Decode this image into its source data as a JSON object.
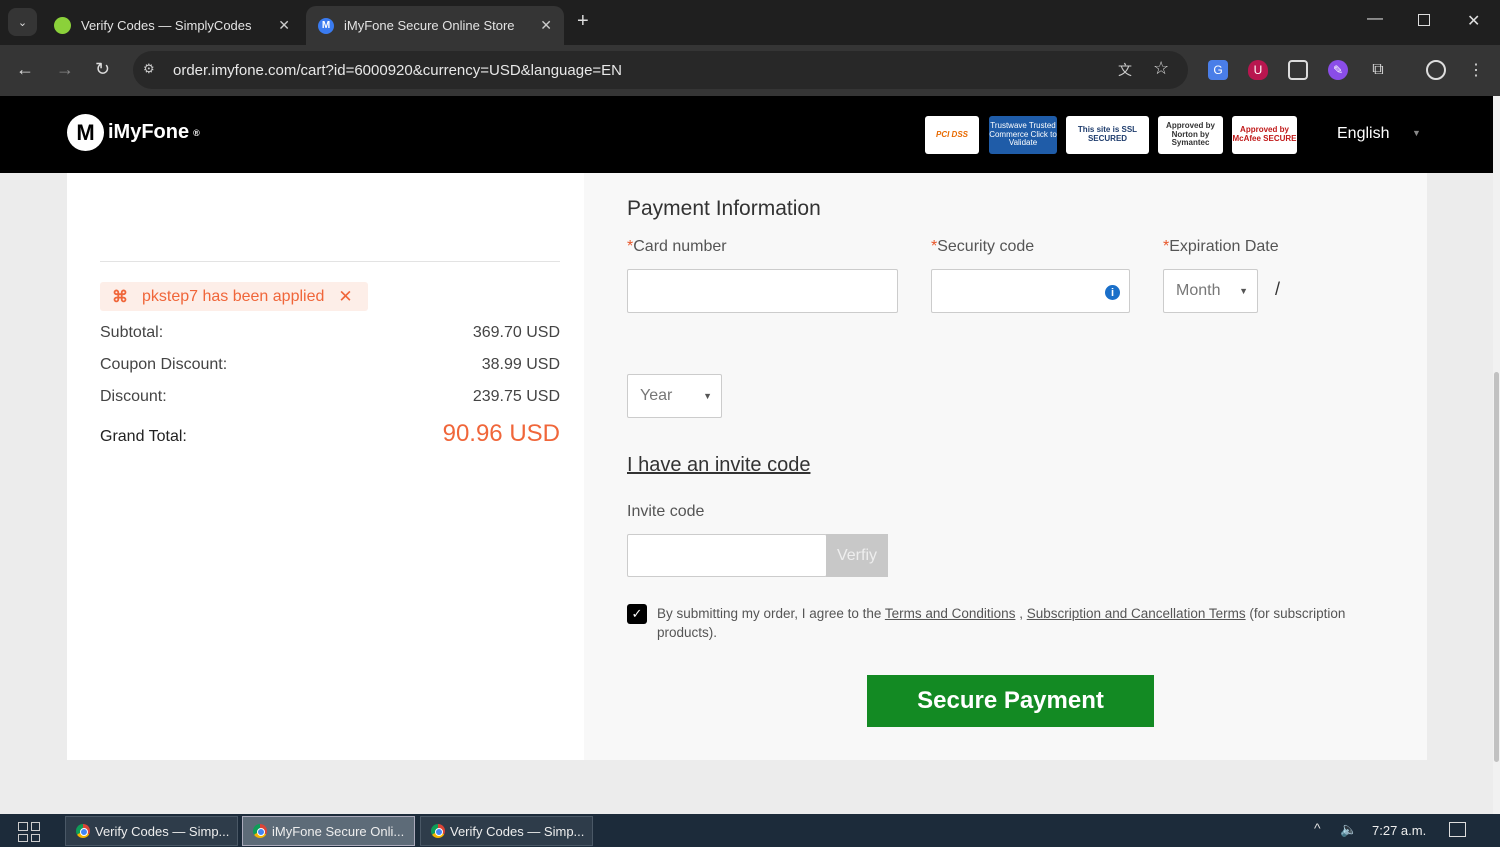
{
  "browser": {
    "tabs": [
      {
        "title": "Verify Codes — SimplyCodes",
        "active": false
      },
      {
        "title": "iMyFone Secure Online Store",
        "active": true
      }
    ],
    "url": "order.imyfone.com/cart?id=6000920&currency=USD&language=EN"
  },
  "header": {
    "logo": "iMyFone",
    "badges": [
      "PCI DSS",
      "Trustwave Trusted Commerce Click to Validate",
      "This site is SSL SECURED",
      "Approved by Norton by Symantec",
      "Approved by McAfee SECURE"
    ],
    "language": "English"
  },
  "summary": {
    "coupon_text": "pkstep7 has been applied",
    "rows": [
      {
        "label": "Subtotal:",
        "value": "369.70 USD"
      },
      {
        "label": "Coupon Discount:",
        "value": "38.99 USD"
      },
      {
        "label": "Discount:",
        "value": "239.75 USD"
      }
    ],
    "grand_total_label": "Grand Total:",
    "grand_total_value": "90.96 USD"
  },
  "payment": {
    "title": "Payment Information",
    "card_label": "Card number",
    "security_label": "Security code",
    "expiration_label": "Expiration Date",
    "required_mark": "*",
    "month_value": "Month",
    "separator": "/",
    "year_value": "Year",
    "invite_link": "I have an invite code",
    "invite_label": "Invite code",
    "verify_label": "Verfiy",
    "agree_prefix": "By submitting my order, I agree to the ",
    "terms_link": "Terms and Conditions",
    "comma": " , ",
    "subscription_link": "Subscription and Cancellation Terms",
    "agree_suffix": " (for subscription products).",
    "agree_checked": true,
    "submit_label": "Secure Payment"
  },
  "taskbar": {
    "items": [
      "Verify Codes — Simp...",
      "iMyFone Secure Onli...",
      "Verify Codes — Simp..."
    ],
    "time": "7:27 a.m."
  },
  "colors": {
    "accent": "#f0663a",
    "submit": "#138a23",
    "header_bg": "#000000"
  }
}
